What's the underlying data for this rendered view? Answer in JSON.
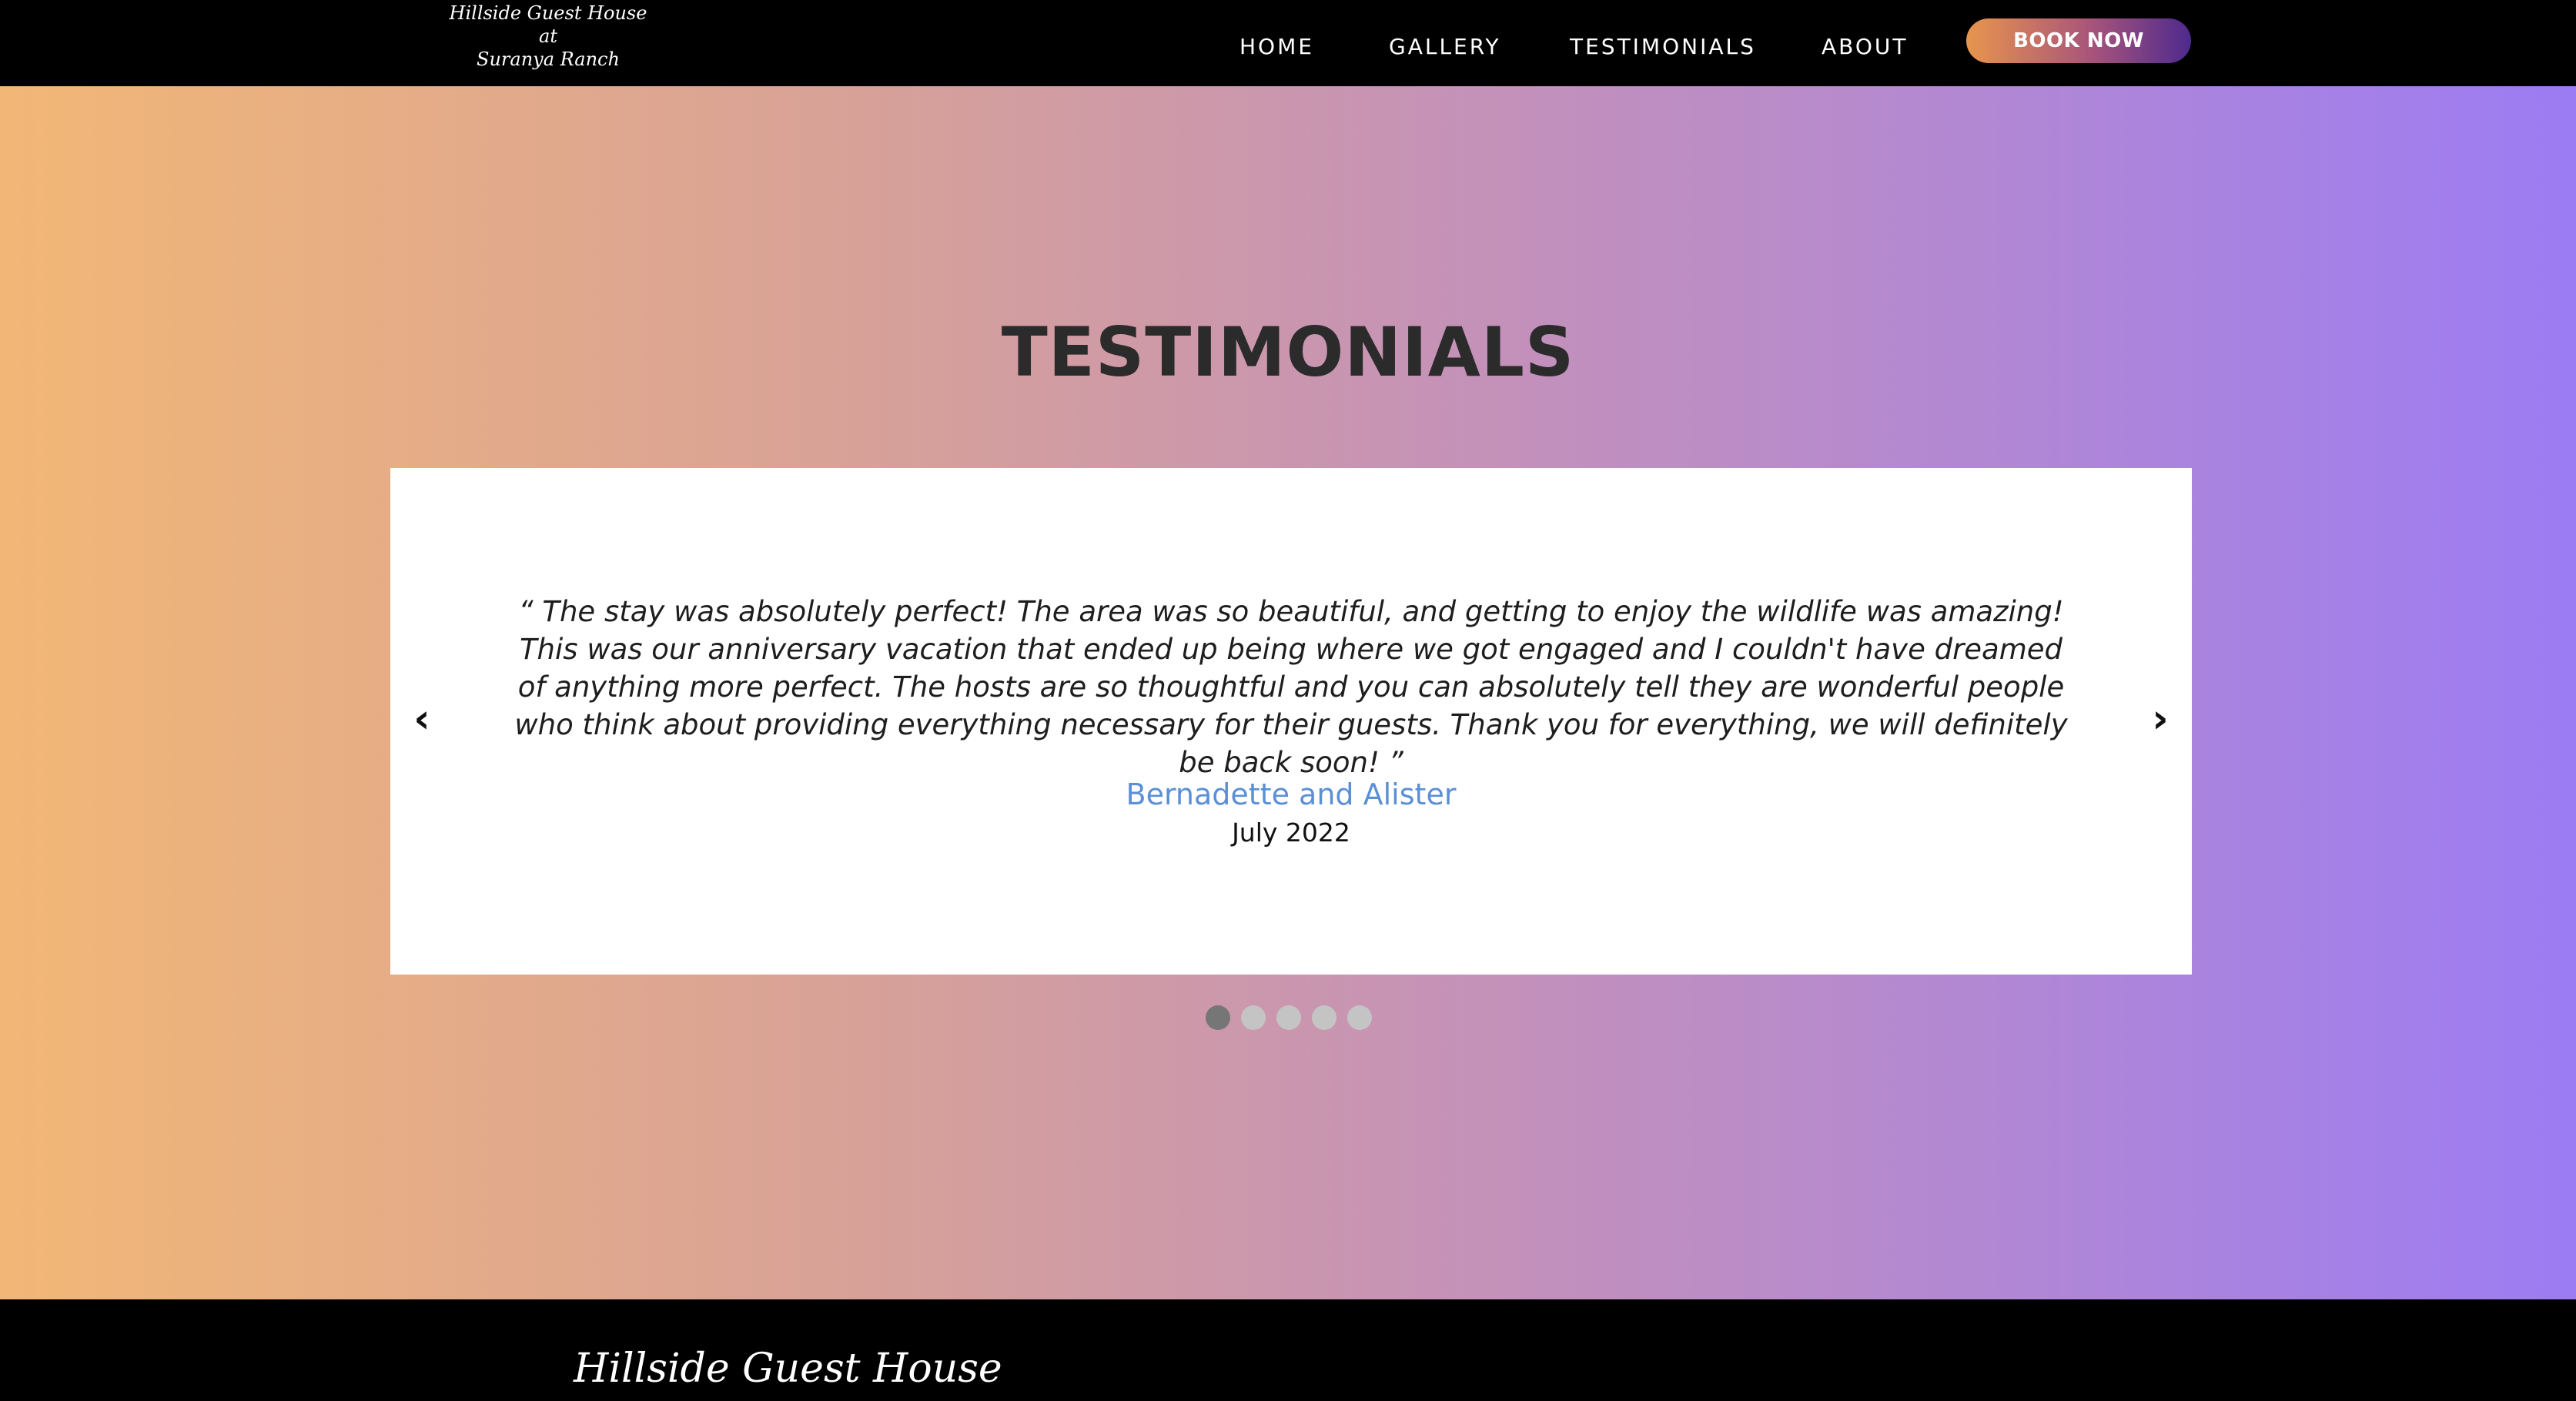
{
  "nav": {
    "logo_line1": "Hillside Guest House",
    "logo_line2": "at",
    "logo_line3": "Suranya Ranch",
    "links": [
      {
        "label": "HOME"
      },
      {
        "label": "GALLERY"
      },
      {
        "label": "TESTIMONIALS"
      },
      {
        "label": "ABOUT"
      }
    ],
    "book_label": "BOOK NOW"
  },
  "testimonials": {
    "title": "TESTIMONIALS",
    "quote": "“ The stay was absolutely perfect! The area was so beautiful, and getting to enjoy the wildlife was amazing! This was our anniversary vacation that ended up being where we got engaged and I couldn't have dreamed of anything more perfect. The hosts are so thoughtful and you can absolutely tell they are wonderful people who think about providing everything necessary for their guests. Thank you for everything, we will definitely be back soon! ”",
    "author": "Bernadette and Alister",
    "date": "July 2022",
    "prev_arrow": "‹",
    "next_arrow": "›",
    "slide_count": 5,
    "active_slide": 1
  },
  "footer": {
    "title": "Hillside Guest House"
  },
  "colors": {
    "nav_bg": "#000000",
    "gradient_start": "#f2b776",
    "gradient_end": "#9c7cf3",
    "author_link": "#5b8fd6",
    "dot_active": "#767676",
    "dot_inactive": "#c4c4c4"
  }
}
